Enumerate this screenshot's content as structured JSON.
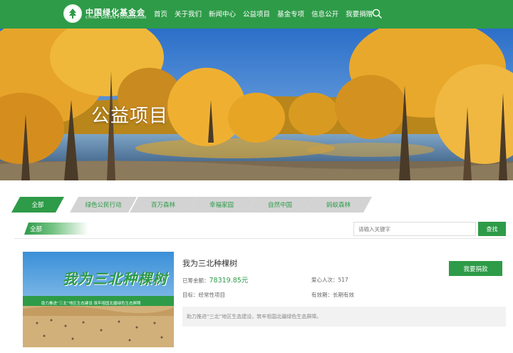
{
  "header": {
    "brand_cn": "中国绿化基金会",
    "brand_en": "CHINA GREEN FOUNDATION",
    "nav": [
      "首页",
      "关于我们",
      "新闻中心",
      "公益项目",
      "基金专项",
      "信息公开",
      "我要捐赠"
    ],
    "colors": {
      "brand": "#2e9b48"
    }
  },
  "banner": {
    "title": "公益项目"
  },
  "tabs": [
    "全部",
    "绿色公民行动",
    "百万森林",
    "幸福家园",
    "自然中国",
    "蚂蚁森林"
  ],
  "filter": {
    "active_label": "全部",
    "search_placeholder": "请输入关键字",
    "search_button": "查找"
  },
  "project": {
    "title": "我为三北种棵树",
    "thumb_title": "我为三北种棵树",
    "thumb_subtitle": "助力推进“三北”地区生态建设  筑牢祖国北疆绿色生态屏障",
    "raised_label": "已筹金额：",
    "raised_value": "78319.85元",
    "donors_label": "爱心人次：",
    "donors_value": "517",
    "target_label": "目标：",
    "target_value": "经常性项目",
    "validity_label": "有效期：",
    "validity_value": "长期有效",
    "donate_button": "我要捐款",
    "description": "助力推进“三北”地区生态建设，筑牢祖国北疆绿色生态屏障。"
  }
}
